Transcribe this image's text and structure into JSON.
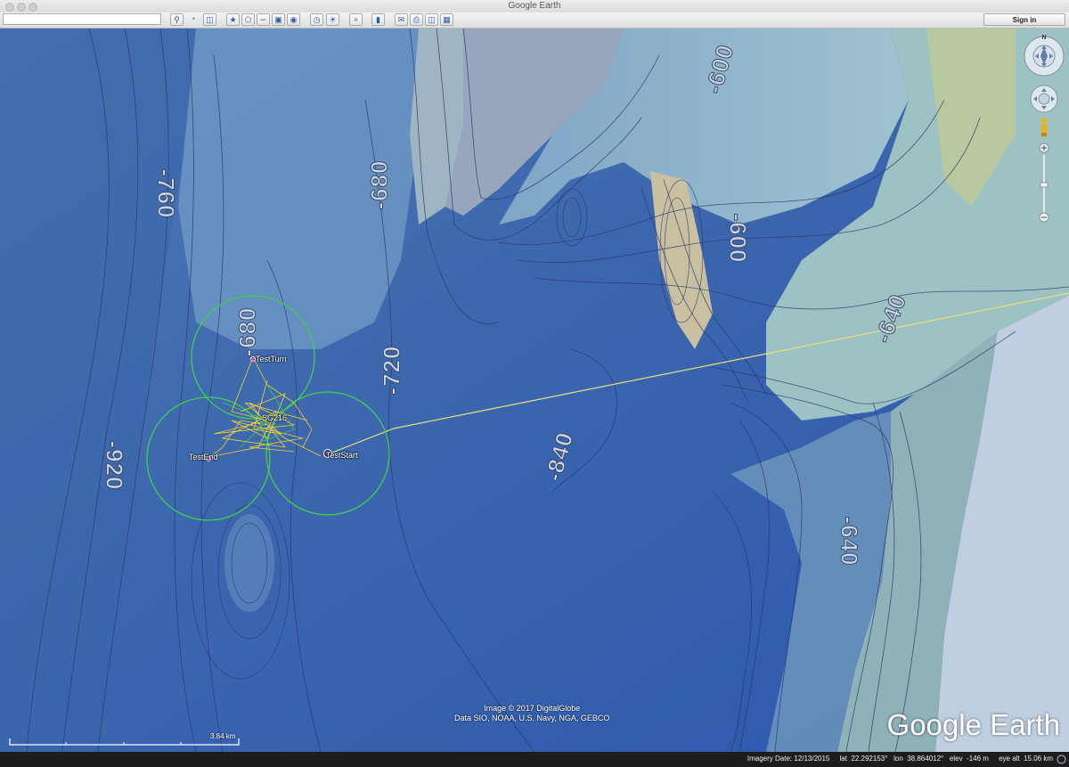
{
  "window": {
    "title": "Google Earth"
  },
  "toolbar": {
    "search_placeholder": "",
    "sign_in_label": "Sign in"
  },
  "map": {
    "depth_labels": [
      "-600",
      "-680",
      "-760",
      "-600",
      "-640",
      "-680",
      "-720",
      "-840",
      "-920",
      "-640"
    ],
    "placemarks": [
      "TestTurn",
      "SG216",
      "TestEnd",
      "TestStart"
    ],
    "attribution_line1": "Image © 2017 DigitalGlobe",
    "attribution_line2": "Data SIO, NOAA, U.S. Navy, NGA, GEBCO",
    "logo": "Google Earth",
    "scale_label": "3.84 km",
    "compass_label": "N"
  },
  "status": {
    "imagery_date": "Imagery Date: 12/13/2015",
    "lat": "lat  22.292153°",
    "lon": "lon  38.864012°",
    "elev": "elev  -146 m",
    "eye_alt": "eye alt  15.06 km"
  },
  "colors": {
    "track": "#f2d233",
    "circle": "#3fd14f",
    "route": "#e8e27a"
  }
}
